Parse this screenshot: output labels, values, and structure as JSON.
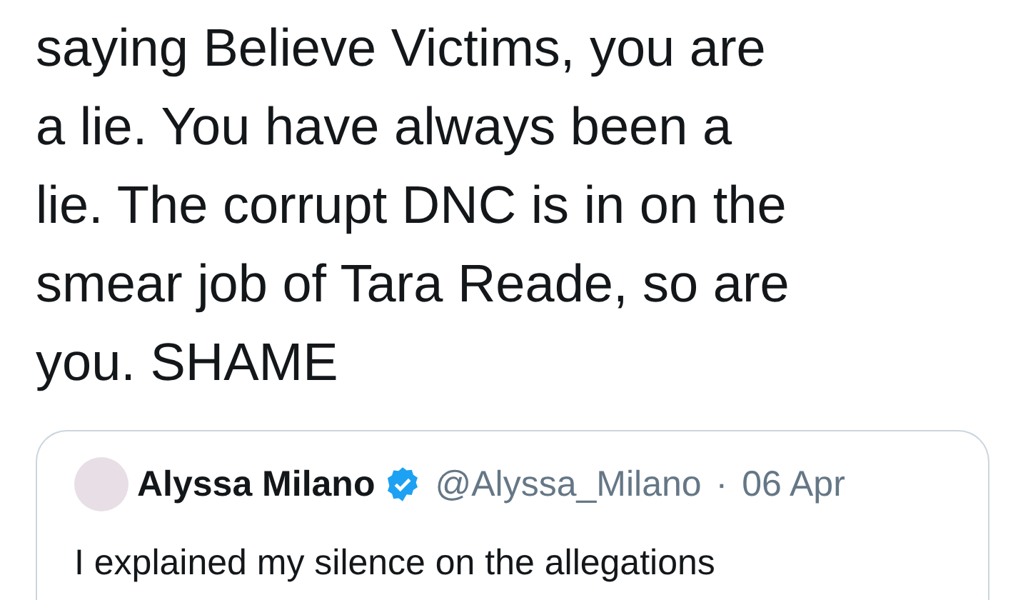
{
  "tweet": {
    "text_lines": [
      "saying Believe Victims, you are",
      "a lie. You have always been a",
      "lie. The corrupt DNC is in on the",
      "smear job of Tara Reade, so are",
      "you. SHAME"
    ]
  },
  "quoted_tweet": {
    "name": "Alyssa Milano",
    "verified": true,
    "handle": "@Alyssa_Milano",
    "separator": "·",
    "date": "06 Apr",
    "text": "I explained my silence on the allegations"
  }
}
